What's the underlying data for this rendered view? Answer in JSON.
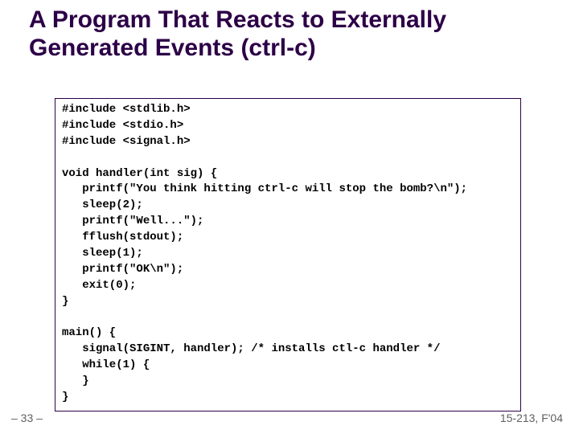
{
  "title": "A Program That Reacts to Externally Generated Events (ctrl-c)",
  "code": "#include <stdlib.h>\n#include <stdio.h>\n#include <signal.h>\n\nvoid handler(int sig) {\n   printf(\"You think hitting ctrl-c will stop the bomb?\\n\");\n   sleep(2);\n   printf(\"Well...\");\n   fflush(stdout);\n   sleep(1);\n   printf(\"OK\\n\");\n   exit(0);\n}\n\nmain() {\n   signal(SIGINT, handler); /* installs ctl-c handler */\n   while(1) {\n   }\n}",
  "footer": {
    "left": "– 33 –",
    "right": "15-213, F'04"
  }
}
